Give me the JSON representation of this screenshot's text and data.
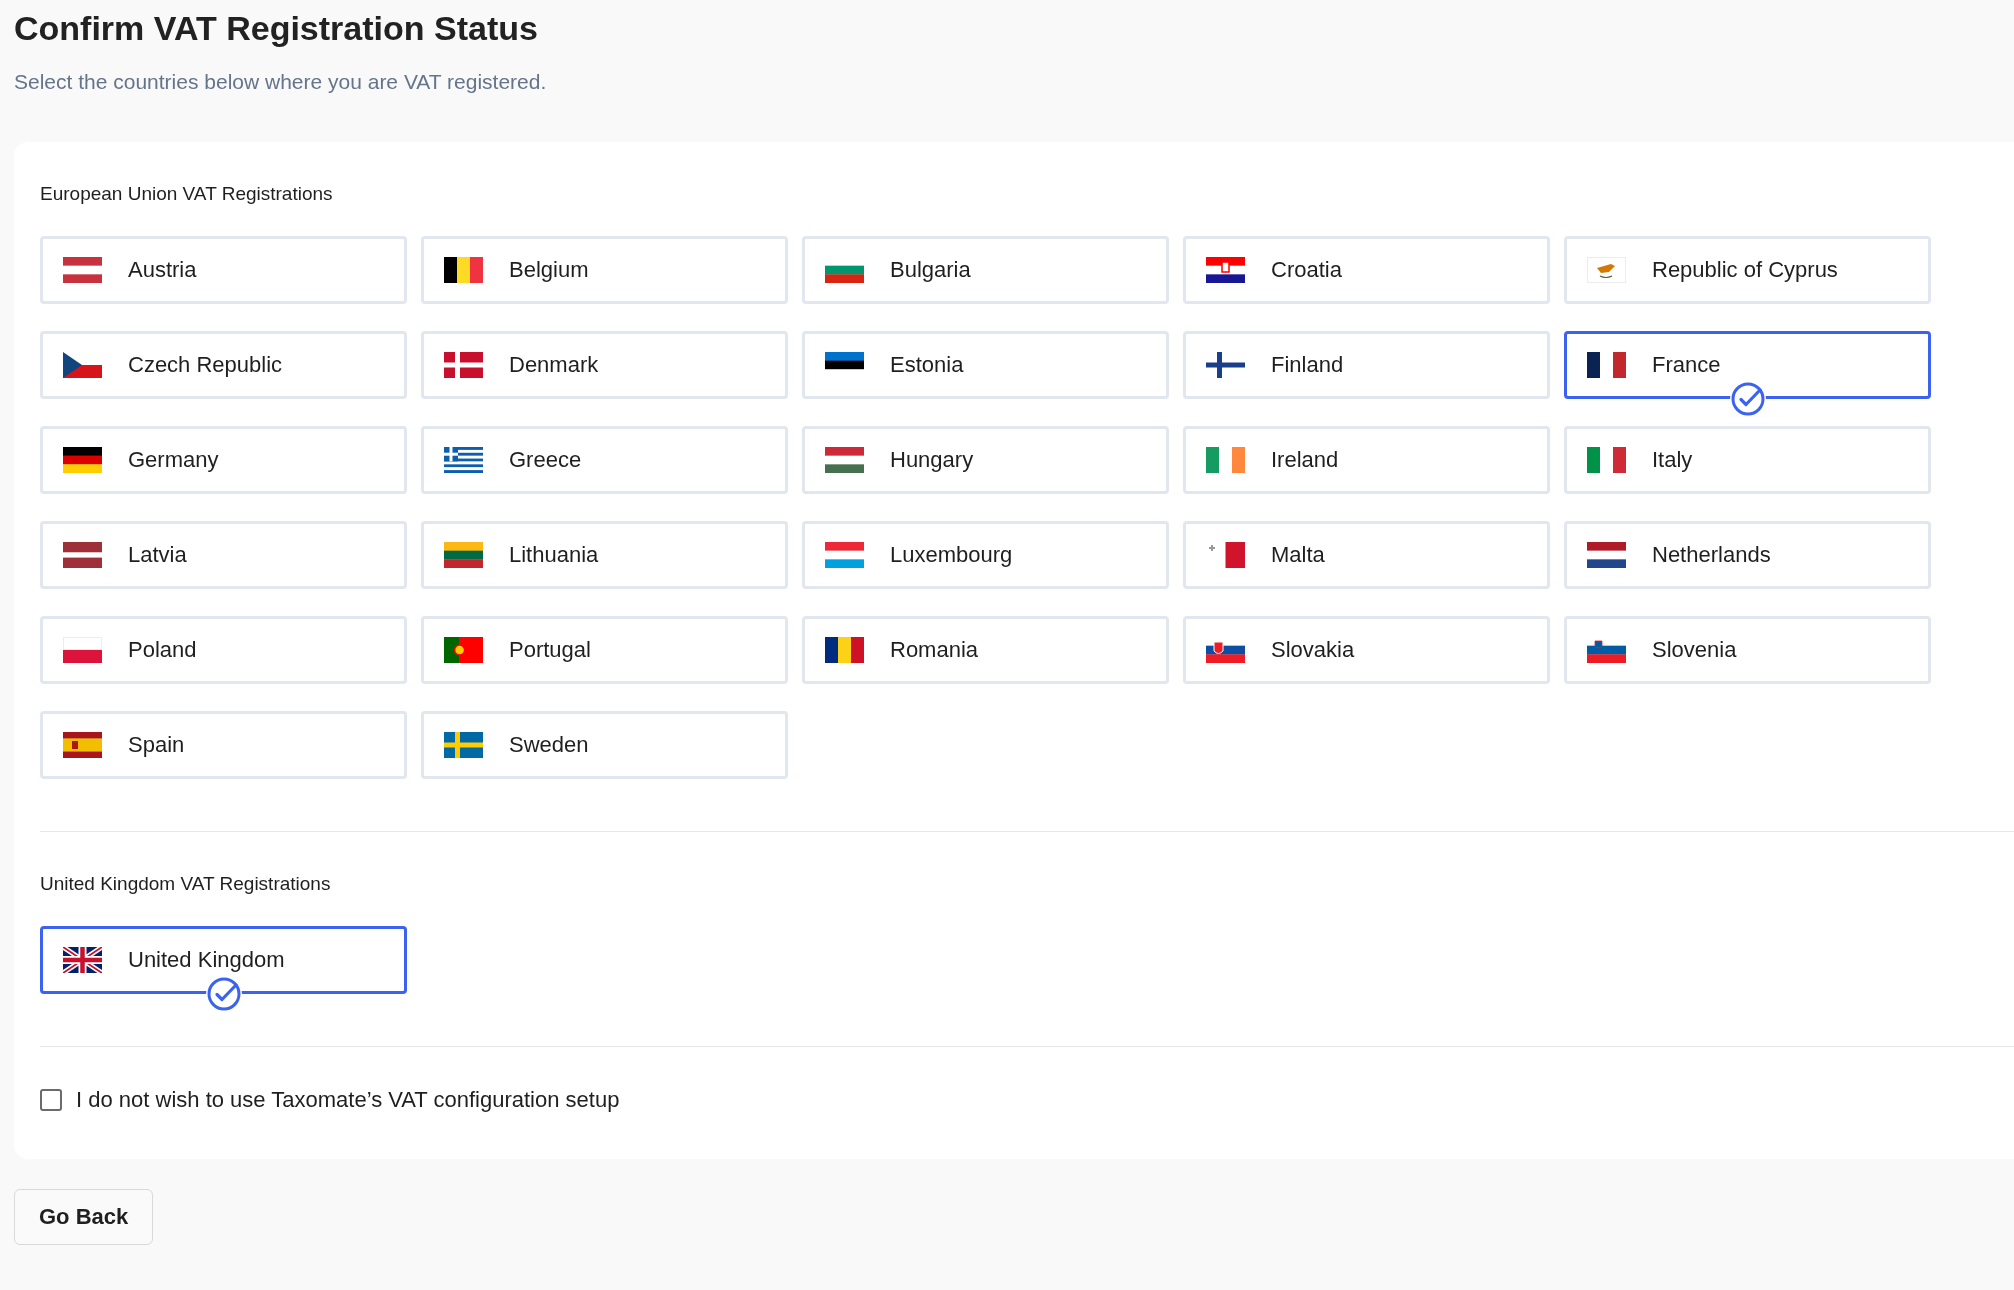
{
  "page": {
    "title": "Confirm VAT Registration Status",
    "subtitle": "Select the countries below where you are VAT registered."
  },
  "sections": [
    {
      "title": "European Union VAT Registrations",
      "countries": [
        {
          "name": "Austria",
          "selected": false
        },
        {
          "name": "Belgium",
          "selected": false
        },
        {
          "name": "Bulgaria",
          "selected": false
        },
        {
          "name": "Croatia",
          "selected": false
        },
        {
          "name": "Republic of Cyprus",
          "selected": false
        },
        {
          "name": "Czech Republic",
          "selected": false
        },
        {
          "name": "Denmark",
          "selected": false
        },
        {
          "name": "Estonia",
          "selected": false
        },
        {
          "name": "Finland",
          "selected": false
        },
        {
          "name": "France",
          "selected": true
        },
        {
          "name": "Germany",
          "selected": false
        },
        {
          "name": "Greece",
          "selected": false
        },
        {
          "name": "Hungary",
          "selected": false
        },
        {
          "name": "Ireland",
          "selected": false
        },
        {
          "name": "Italy",
          "selected": false
        },
        {
          "name": "Latvia",
          "selected": false
        },
        {
          "name": "Lithuania",
          "selected": false
        },
        {
          "name": "Luxembourg",
          "selected": false
        },
        {
          "name": "Malta",
          "selected": false
        },
        {
          "name": "Netherlands",
          "selected": false
        },
        {
          "name": "Poland",
          "selected": false
        },
        {
          "name": "Portugal",
          "selected": false
        },
        {
          "name": "Romania",
          "selected": false
        },
        {
          "name": "Slovakia",
          "selected": false
        },
        {
          "name": "Slovenia",
          "selected": false
        },
        {
          "name": "Spain",
          "selected": false
        },
        {
          "name": "Sweden",
          "selected": false
        }
      ]
    },
    {
      "title": "United Kingdom VAT Registrations",
      "countries": [
        {
          "name": "United Kingdom",
          "selected": true
        }
      ]
    }
  ],
  "opt_out": {
    "label": "I do not wish to use Taxomate’s VAT configuration setup",
    "checked": false
  },
  "back_button": {
    "label": "Go Back"
  }
}
